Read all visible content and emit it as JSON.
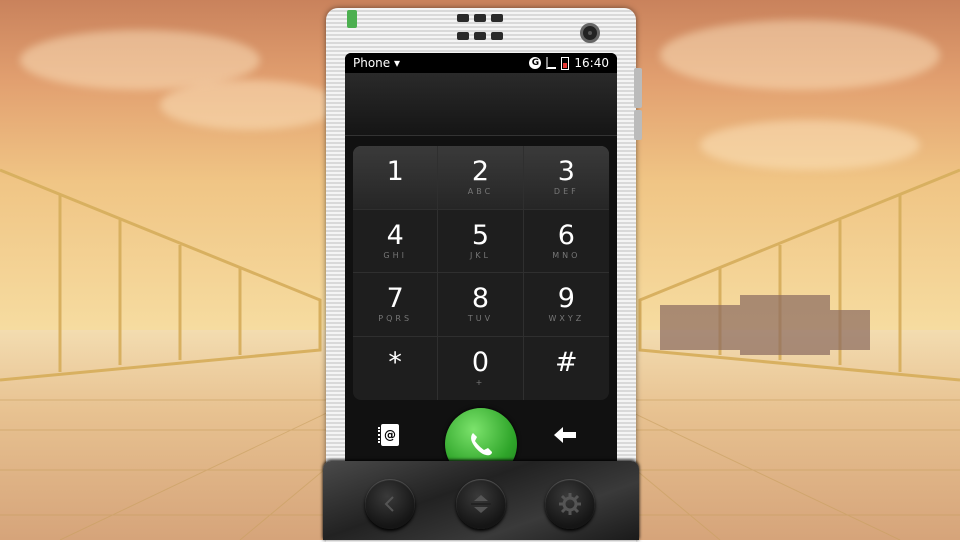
{
  "status_bar": {
    "app_name": "Phone ▾",
    "network_icon": "g-network-icon",
    "signal_icon": "signal-icon",
    "battery_icon": "battery-low-icon",
    "time": "16:40"
  },
  "keypad": {
    "keys": [
      {
        "digit": "1",
        "letters": ""
      },
      {
        "digit": "2",
        "letters": "ABC"
      },
      {
        "digit": "3",
        "letters": "DEF"
      },
      {
        "digit": "4",
        "letters": "GHI"
      },
      {
        "digit": "5",
        "letters": "JKL"
      },
      {
        "digit": "6",
        "letters": "MNO"
      },
      {
        "digit": "7",
        "letters": "PQRS"
      },
      {
        "digit": "8",
        "letters": "TUV"
      },
      {
        "digit": "9",
        "letters": "WXYZ"
      },
      {
        "digit": "*",
        "letters": ""
      },
      {
        "digit": "0",
        "letters": "+"
      },
      {
        "digit": "#",
        "letters": ""
      }
    ]
  },
  "actions": {
    "contacts_glyph": "@",
    "contacts_icon": "contacts-book-icon",
    "call_icon": "phone-handset-icon",
    "delete_icon": "backspace-arrow-icon"
  },
  "hardware": {
    "back_icon": "chevron-left-icon",
    "nav_icon": "up-down-arrows-icon",
    "settings_icon": "gear-icon"
  },
  "colors": {
    "call_green": "#2fa52a",
    "battery_red": "#e53935",
    "led_green": "#4caf50"
  }
}
